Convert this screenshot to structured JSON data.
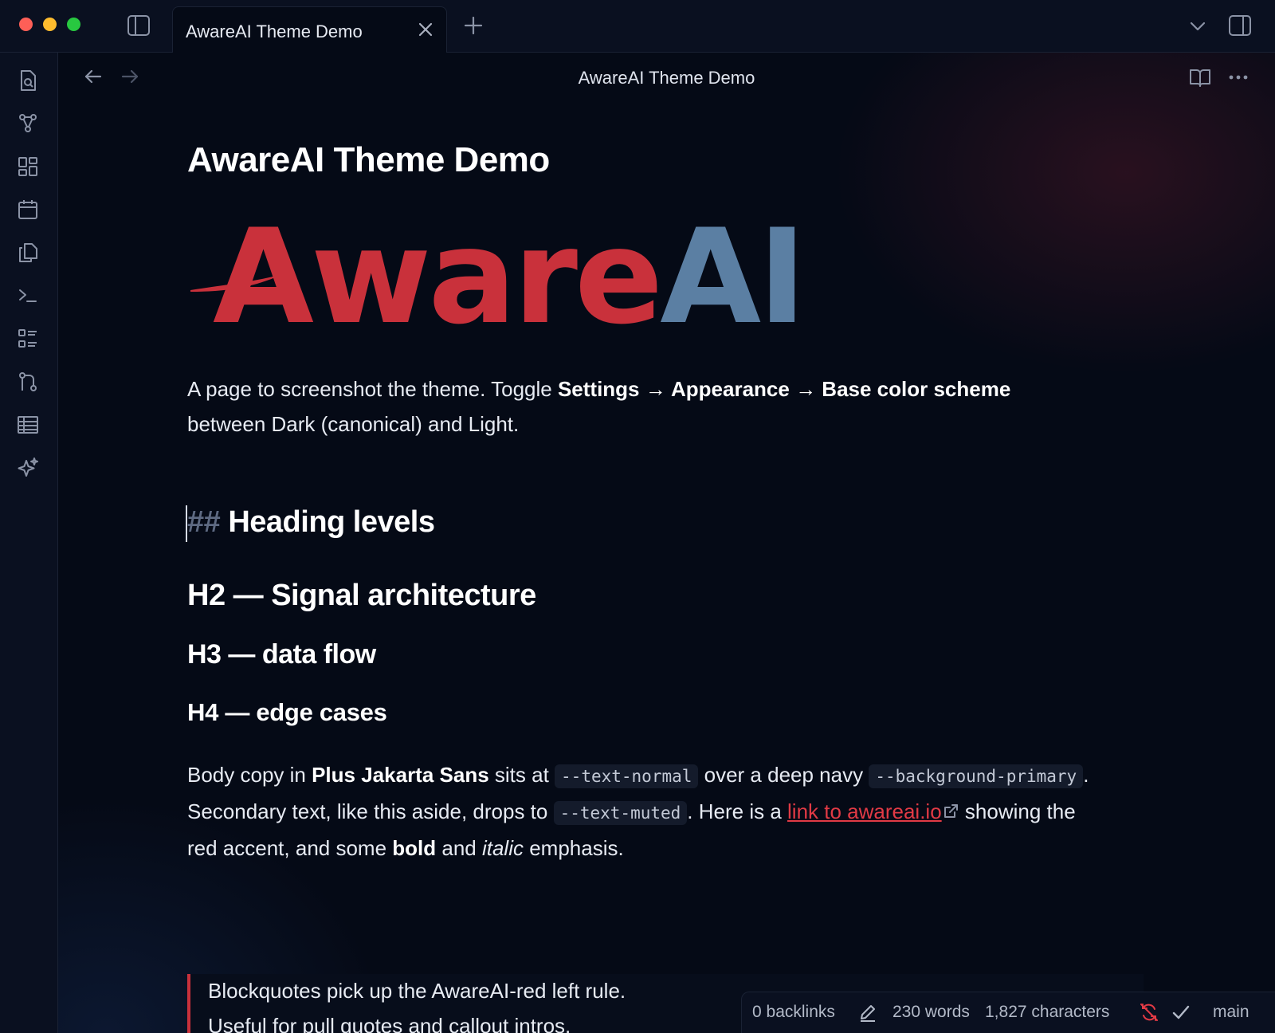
{
  "tab": {
    "title": "AwareAI Theme Demo"
  },
  "nav": {
    "title": "AwareAI Theme Demo"
  },
  "doc": {
    "title": "AwareAI Theme Demo",
    "logo": {
      "word_red": "Aware",
      "word_blue": "AI"
    },
    "intro": {
      "t1": "A page to screenshot the theme. Toggle ",
      "b1": "Settings → Appearance → Base color scheme",
      "t2": "between Dark (canonical) and Light."
    },
    "heading_md": {
      "marker": "##",
      "text": " Heading levels"
    },
    "h2": "H2 — Signal architecture",
    "h3": "H3 — data flow",
    "h4": "H4 — edge cases",
    "body": {
      "t1": "Body copy in ",
      "b1": "Plus Jakarta Sans",
      "t2": " sits at ",
      "c1": "--text-normal",
      "t3": " over a deep navy ",
      "c2": "--background-primary",
      "t4": ".",
      "t5": "Secondary text, like this aside, drops to ",
      "c3": "--text-muted",
      "t6": ". Here is a ",
      "link": "link to awareai.io",
      "t7": " showing the",
      "t8": "red accent, and some ",
      "b2": "bold",
      "t9": " and ",
      "i1": "italic",
      "t10": " emphasis."
    },
    "quote": {
      "line1": "Blockquotes pick up the AwareAI-red left rule.",
      "line2": "Useful for pull quotes and callout intros."
    }
  },
  "status": {
    "backlinks": "0 backlinks",
    "words": "230 words",
    "characters": "1,827 characters",
    "branch": "main"
  },
  "colors": {
    "accent_red": "#c9313b",
    "accent_blue": "#5b7fa3",
    "background": "#050a16"
  }
}
